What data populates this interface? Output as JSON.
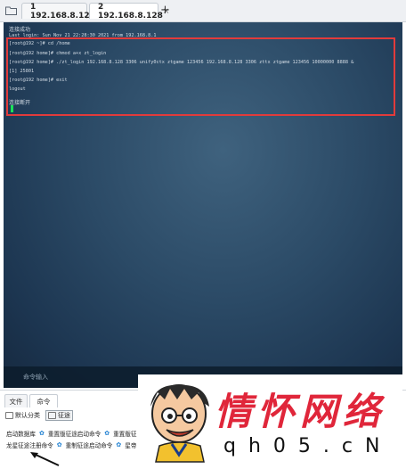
{
  "tabs": [
    {
      "label": "1 192.168.8.128",
      "dot_color": "#23a455"
    },
    {
      "label": "2 192.168.8.128",
      "dot_color": "#e5243b"
    }
  ],
  "tab_close": "×",
  "new_tab": "+",
  "terminal": {
    "lines": [
      "连接成功",
      "Last login: Sun Nov 21 22:28:30 2021 from 192.168.8.1",
      "[root@192 ~]# cd /home",
      "[root@192 home]# chmod a+x zt_login",
      "[root@192 home]# ./zt_login 192.168.8.128 3306 unify0ctx ztgame 123456 192.168.8.128 3306 zttx ztgame 123456 10000000 8888 &",
      "[1] 25801",
      "[root@192 home]# exit",
      "logout",
      "",
      "连接断开"
    ],
    "input_placeholder": "命令输入"
  },
  "panel": {
    "tabs": [
      "文件",
      "命令"
    ],
    "categories": [
      "默认分类",
      "征途"
    ],
    "row1": [
      "启动数据库",
      "重置版征途启动命令",
      "重置版征"
    ],
    "row2": [
      "龙星征途注册命令",
      "重制征途启动命令",
      "星帝"
    ]
  },
  "watermark": {
    "title": "情怀网络",
    "subtitle": "qh05.cN"
  }
}
